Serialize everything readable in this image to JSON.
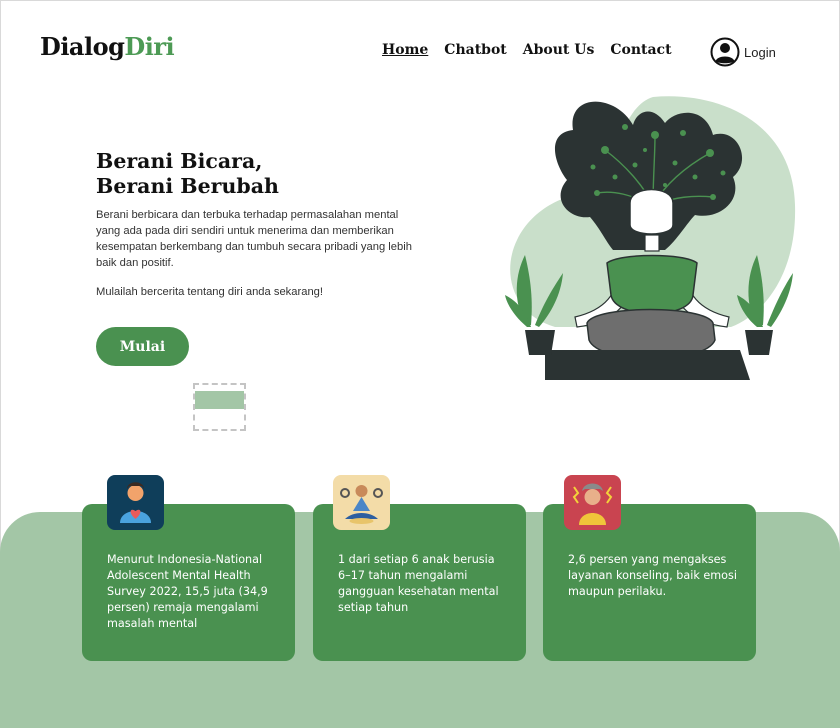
{
  "brand": {
    "part1": "Dialog",
    "part2": "Diri"
  },
  "nav": [
    {
      "label": "Home",
      "active": true
    },
    {
      "label": "Chatbot"
    },
    {
      "label": "About Us"
    },
    {
      "label": "Contact"
    }
  ],
  "login": {
    "label": "Login"
  },
  "hero": {
    "title_line1": "Berani Bicara,",
    "title_line2": "Berani Berubah",
    "description": "Berani berbicara dan terbuka terhadap permasalahan mental yang ada pada diri sendiri untuk menerima  dan memberikan kesempatan berkembang dan tumbuh secara pribadi yang lebih baik dan positif.",
    "cta_text": "Mulailah bercerita tentang diri anda sekarang!",
    "button": "Mulai"
  },
  "stats": [
    {
      "icon": "person-heart-icon",
      "text": "Menurut Indonesia-National Adolescent Mental Health Survey 2022, 15,5 juta (34,9 persen) remaja mengalami masalah mental"
    },
    {
      "icon": "meditation-gears-icon",
      "text": "1 dari setiap 6 anak berusia 6–17 tahun mengalami gangguan kesehatan mental setiap tahun"
    },
    {
      "icon": "stressed-person-icon",
      "text": "2,6 persen yang mengakses layanan konseling, baik emosi maupun perilaku."
    }
  ],
  "colors": {
    "primary": "#4a9150",
    "light": "#a3c6a6",
    "dark": "#2b3333"
  }
}
